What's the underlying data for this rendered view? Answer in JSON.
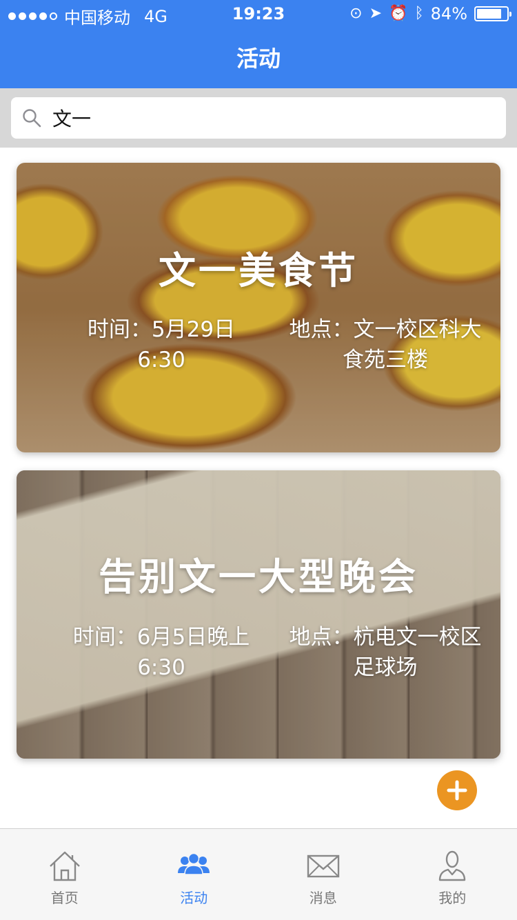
{
  "status": {
    "carrier": "中国移动",
    "network": "4G",
    "time": "19:23",
    "battery": "84%",
    "battery_level": 0.84
  },
  "nav": {
    "title": "活动"
  },
  "search": {
    "value": "文一",
    "icon": "search-icon"
  },
  "events": [
    {
      "title": "文一美食节",
      "time": "时间：5月29日6:30",
      "place": "地点：文一校区科大食苑三楼"
    },
    {
      "title": "告别文一大型晚会",
      "time": "时间：6月5日晚上6:30",
      "place": "地点：杭电文一校区足球场"
    }
  ],
  "fab": {
    "icon": "plus-icon"
  },
  "tabs": [
    {
      "label": "首页",
      "icon": "home-icon",
      "active": false
    },
    {
      "label": "活动",
      "icon": "people-icon",
      "active": true
    },
    {
      "label": "消息",
      "icon": "mail-icon",
      "active": false
    },
    {
      "label": "我的",
      "icon": "user-icon",
      "active": false
    }
  ],
  "colors": {
    "primary": "#3b82f0",
    "accent": "#eb9522",
    "tab_inactive": "#777777"
  }
}
